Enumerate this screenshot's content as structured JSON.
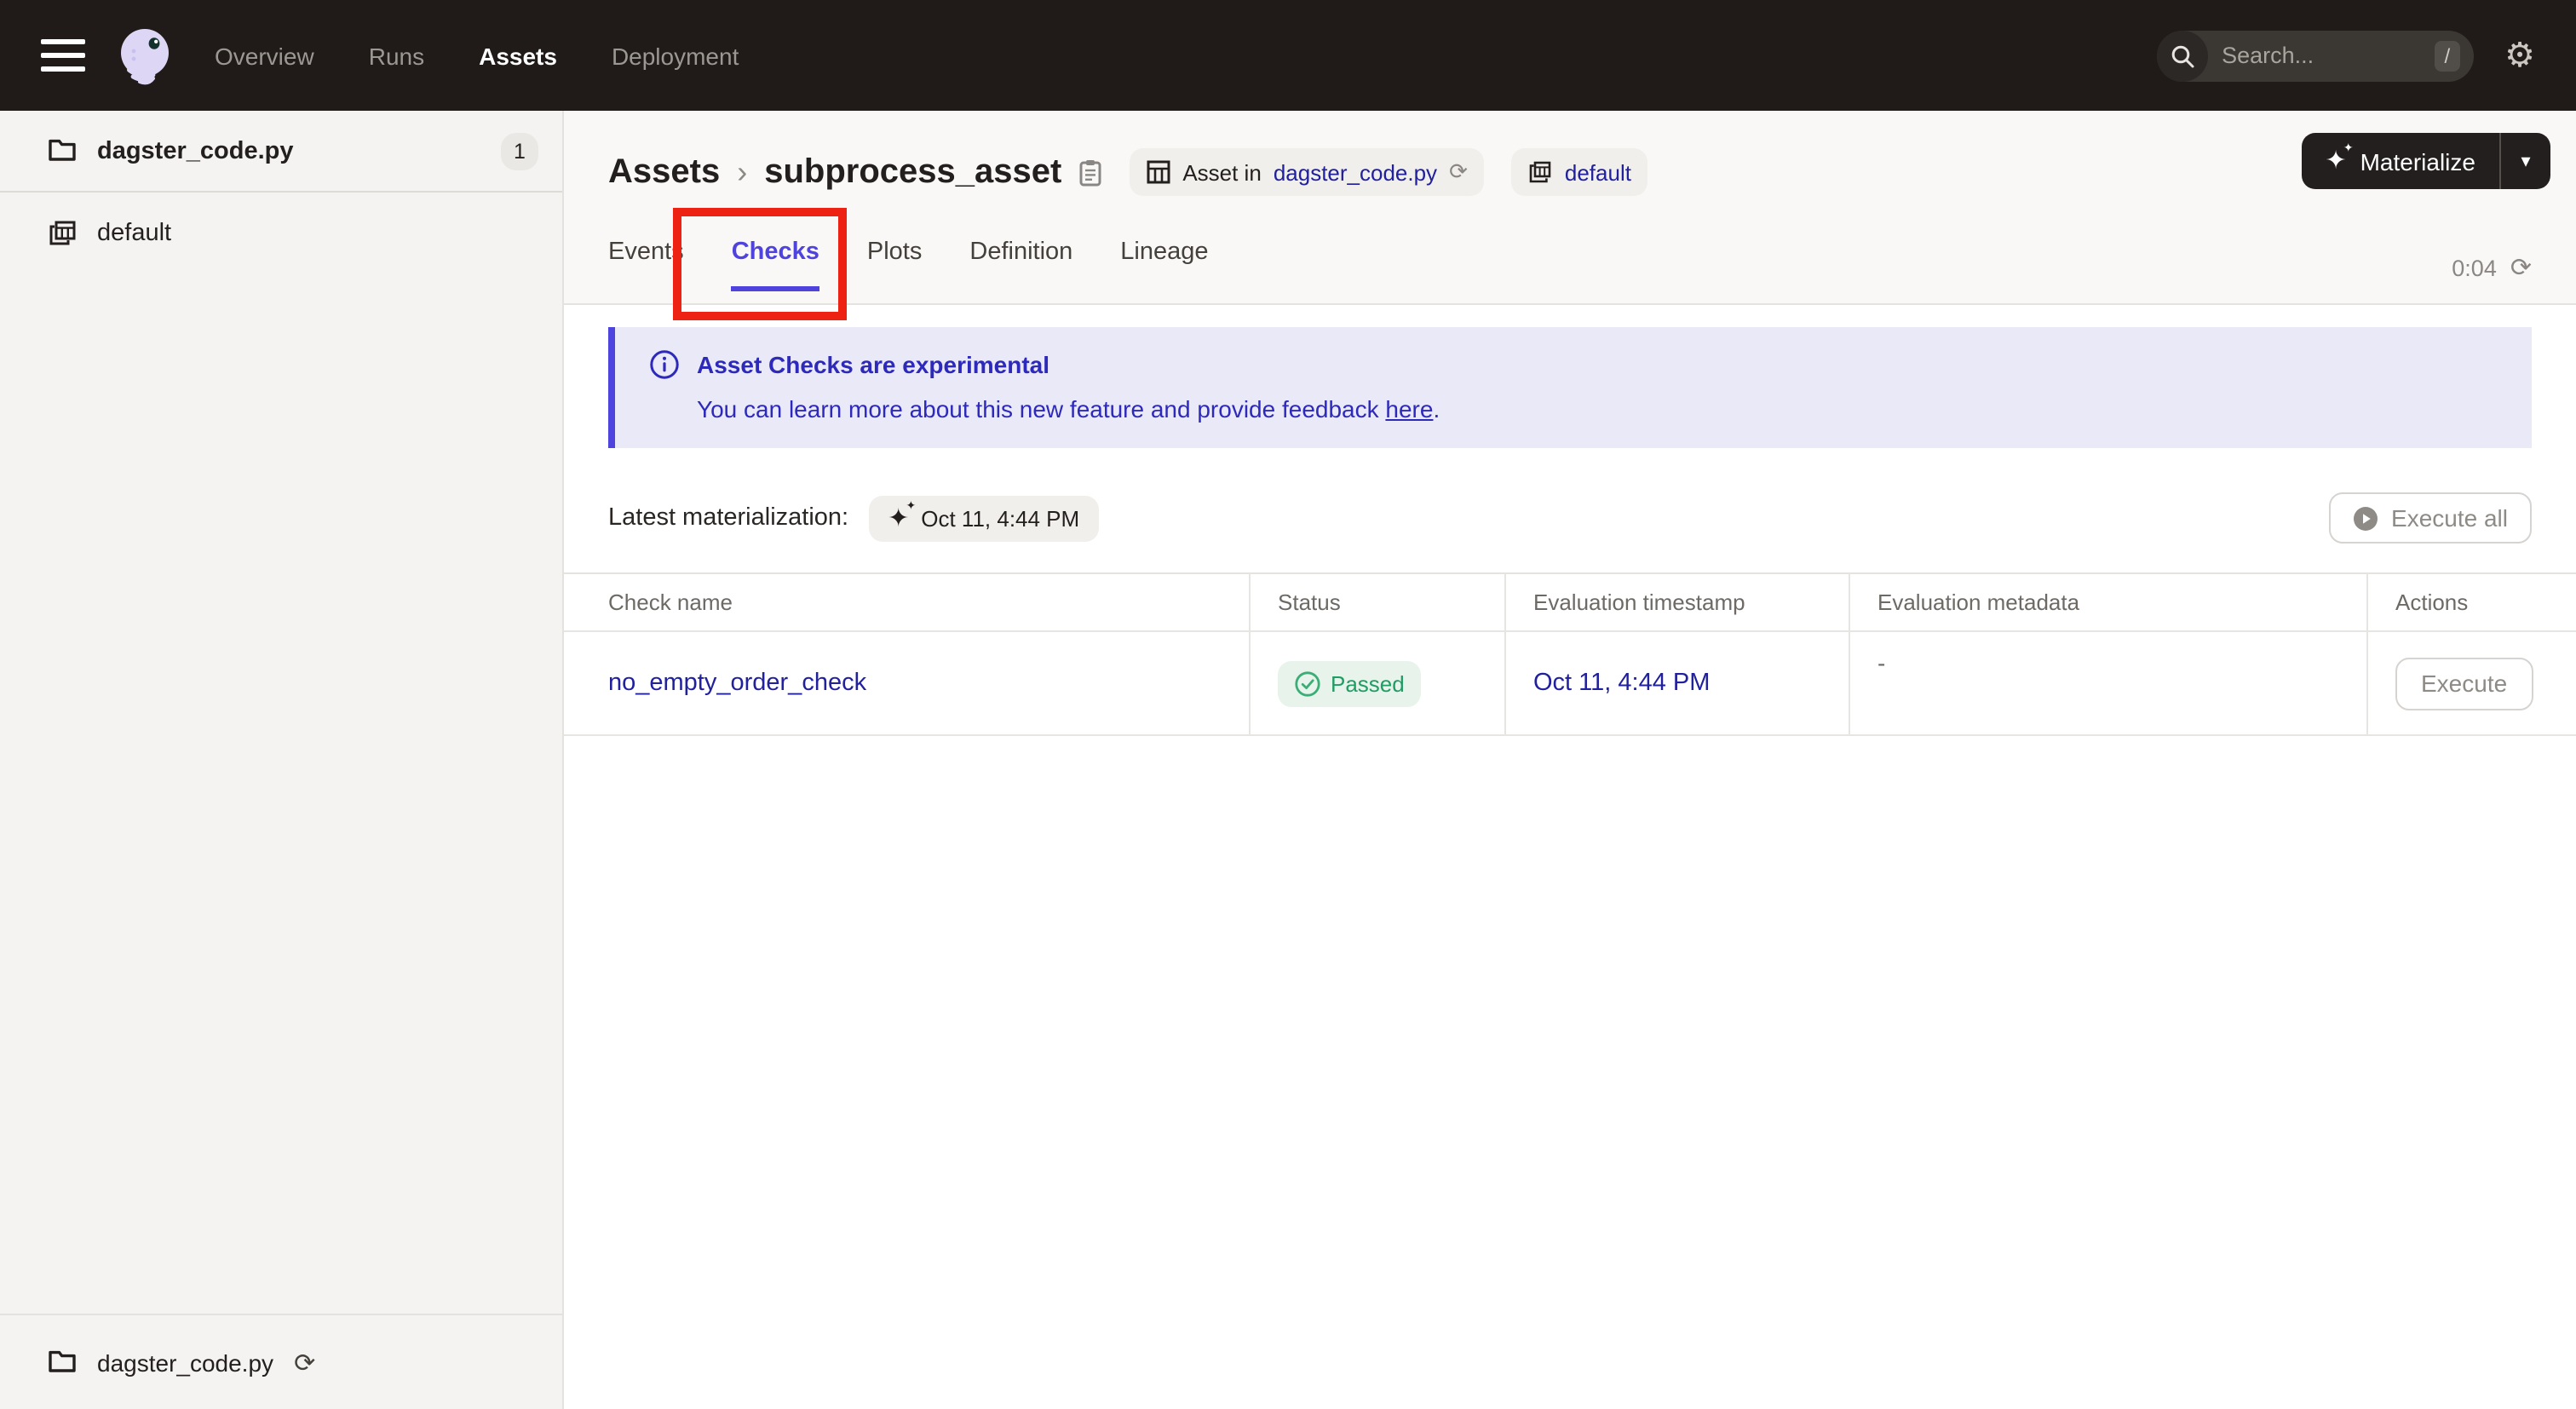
{
  "nav": {
    "items": [
      {
        "label": "Overview",
        "active": false
      },
      {
        "label": "Runs",
        "active": false
      },
      {
        "label": "Assets",
        "active": true
      },
      {
        "label": "Deployment",
        "active": false
      }
    ],
    "search": {
      "placeholder": "Search...",
      "shortcut": "/"
    }
  },
  "sidebar": {
    "items": [
      {
        "label": "dagster_code.py",
        "count": "1"
      },
      {
        "label": "default"
      }
    ],
    "footer": {
      "label": "dagster_code.py"
    }
  },
  "header": {
    "breadcrumb_root": "Assets",
    "title": "subprocess_asset",
    "tag_asset_prefix": "Asset in",
    "tag_asset_link": "dagster_code.py",
    "tag_group_link": "default",
    "materialize_label": "Materialize"
  },
  "tabs": {
    "items": [
      "Events",
      "Checks",
      "Plots",
      "Definition",
      "Lineage"
    ],
    "active": "Checks",
    "timer": "0:04"
  },
  "banner": {
    "title": "Asset Checks are experimental",
    "body_prefix": "You can learn more about this new feature and provide feedback ",
    "link": "here",
    "suffix": "."
  },
  "materialization": {
    "label": "Latest materialization:",
    "value": "Oct 11, 4:44 PM",
    "execute_all_label": "Execute all"
  },
  "table": {
    "columns": [
      "Check name",
      "Status",
      "Evaluation timestamp",
      "Evaluation metadata",
      "Actions"
    ],
    "rows": [
      {
        "name": "no_empty_order_check",
        "status": "Passed",
        "timestamp": "Oct 11, 4:44 PM",
        "metadata": "-",
        "action_label": "Execute"
      }
    ]
  },
  "colors": {
    "accent_blurple": "#4f43dd",
    "link_navy": "#21209d",
    "status_green": "#1f9d63",
    "annotation_red": "#ee2213",
    "topnav_bg": "#201b19",
    "banner_bg": "#eae9f7"
  }
}
